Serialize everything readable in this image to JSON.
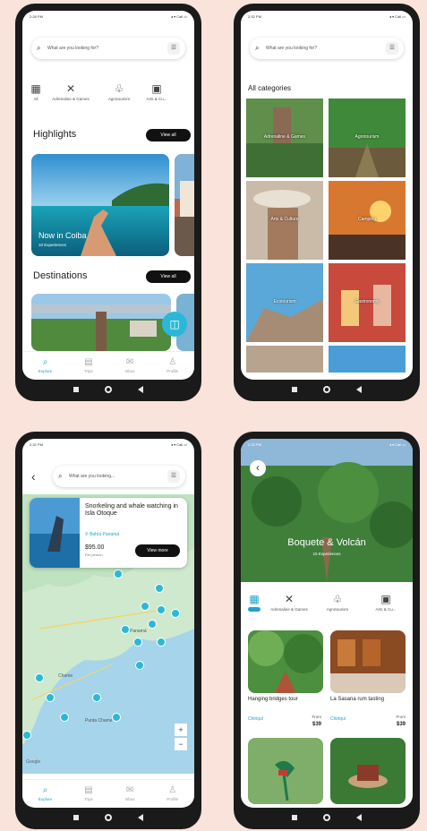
{
  "status": {
    "time_1": "2:28 PM",
    "time_2": "2:32 PM",
    "time_3": "2:32 PM",
    "time_4": "2:33 PM",
    "icons": "◂ ▾ Call ▭"
  },
  "search": {
    "placeholder": "What are you looking for?",
    "placeholder_short": "What are you looking..."
  },
  "categories": [
    {
      "label": "All",
      "icon": "grid-icon"
    },
    {
      "label": "Adrenaline & Games",
      "icon": "adventure-icon"
    },
    {
      "label": "Agrotourism",
      "icon": "leaf-icon"
    },
    {
      "label": "Arts & Cu...",
      "icon": "camera-icon"
    }
  ],
  "home": {
    "highlights_title": "Highlights",
    "view_all": "View all",
    "highlight_card_title": "Now in Coiba",
    "highlight_card_sub": "10 Experiences",
    "destinations_title": "Destinations"
  },
  "tabs": [
    {
      "label": "Explore",
      "icon": "search-icon"
    },
    {
      "label": "Trips",
      "icon": "calendar-icon"
    },
    {
      "label": "Inbox",
      "icon": "inbox-icon"
    },
    {
      "label": "Profile",
      "icon": "profile-icon"
    }
  ],
  "all_categories": {
    "title": "All categories",
    "tiles": [
      "Adrenaline & Games",
      "Agrotourism",
      "Arts & Culture",
      "Camping",
      "Ecotourism",
      "Gastronomy"
    ]
  },
  "map": {
    "card_title": "Snorkeling and whale watching in Isla Otoque",
    "card_location": "Bahía Panamá",
    "card_price": "$95.00",
    "card_per": "Per person",
    "card_button": "View more",
    "map_label_1": "Panamá",
    "map_label_2": "Chame",
    "map_label_3": "Punta Chame",
    "google": "Google"
  },
  "destination": {
    "title": "Boquete & Volcán",
    "subtitle": "15 Experiences",
    "products": [
      {
        "name": "Hanging bridges tour",
        "location": "Chiriquí",
        "from": "From",
        "price": "$39"
      },
      {
        "name": "La Sasana rum tasting",
        "location": "Chiriquí",
        "from": "From",
        "price": "$39"
      }
    ]
  },
  "colors": {
    "accent": "#22a3c7",
    "background": "#f9e3da",
    "phone": "#1a1a1a"
  }
}
